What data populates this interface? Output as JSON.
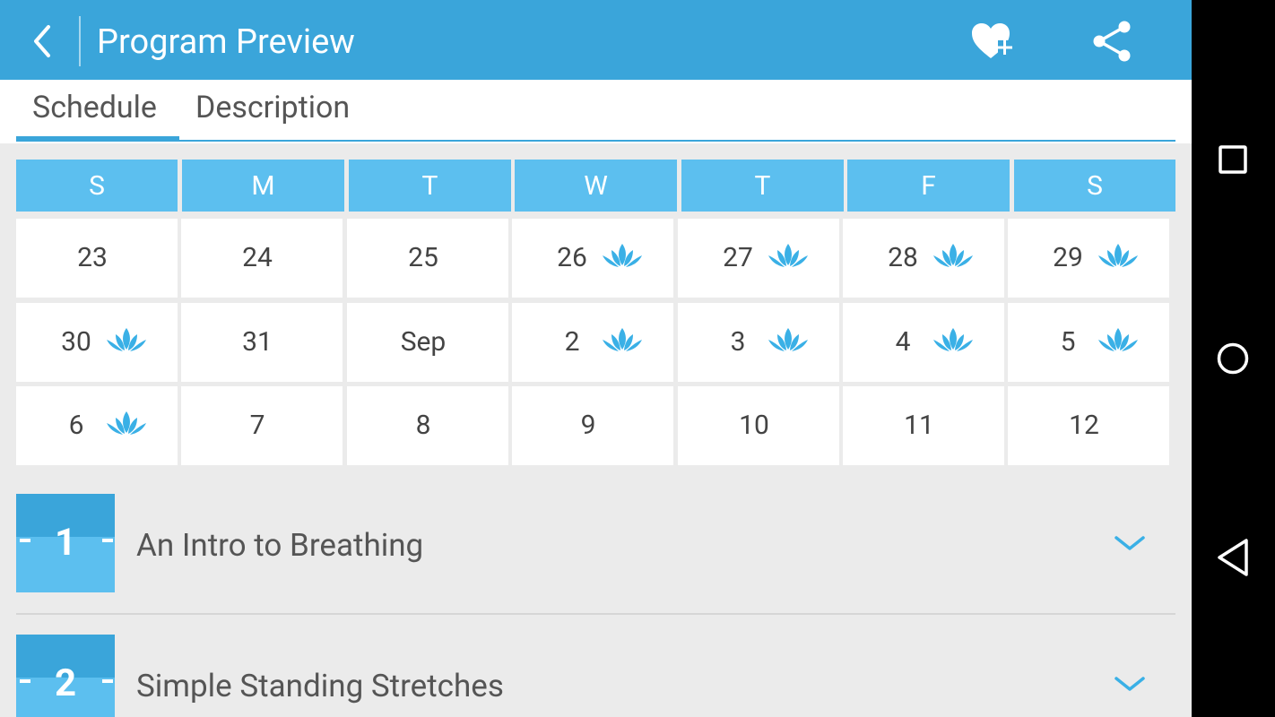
{
  "appbar": {
    "title": "Program Preview",
    "back_icon": "chevron-left-icon",
    "favorite_icon": "heart-plus-icon",
    "share_icon": "share-icon"
  },
  "tabs": [
    {
      "label": "Schedule",
      "active": true
    },
    {
      "label": "Description",
      "active": false
    }
  ],
  "calendar": {
    "weekdays": [
      "S",
      "M",
      "T",
      "W",
      "T",
      "F",
      "S"
    ],
    "weeks": [
      [
        {
          "label": "23",
          "session": false
        },
        {
          "label": "24",
          "session": false
        },
        {
          "label": "25",
          "session": false
        },
        {
          "label": "26",
          "session": true
        },
        {
          "label": "27",
          "session": true
        },
        {
          "label": "28",
          "session": true
        },
        {
          "label": "29",
          "session": true
        }
      ],
      [
        {
          "label": "30",
          "session": true
        },
        {
          "label": "31",
          "session": false
        },
        {
          "label": "Sep",
          "session": false
        },
        {
          "label": "2",
          "session": true
        },
        {
          "label": "3",
          "session": true
        },
        {
          "label": "4",
          "session": true
        },
        {
          "label": "5",
          "session": true
        }
      ],
      [
        {
          "label": "6",
          "session": true
        },
        {
          "label": "7",
          "session": false
        },
        {
          "label": "8",
          "session": false
        },
        {
          "label": "9",
          "session": false
        },
        {
          "label": "10",
          "session": false
        },
        {
          "label": "11",
          "session": false
        },
        {
          "label": "12",
          "session": false
        }
      ]
    ]
  },
  "sessions": [
    {
      "number": "1",
      "title": "An Intro to Breathing"
    },
    {
      "number": "2",
      "title": "Simple Standing Stretches"
    }
  ],
  "colors": {
    "primary": "#3aa5da",
    "header_cell": "#5cbfef",
    "lotus": "#3ab0e6"
  },
  "navbar": {
    "recents_icon": "square-icon",
    "home_icon": "circle-icon",
    "back_icon": "triangle-back-icon"
  }
}
